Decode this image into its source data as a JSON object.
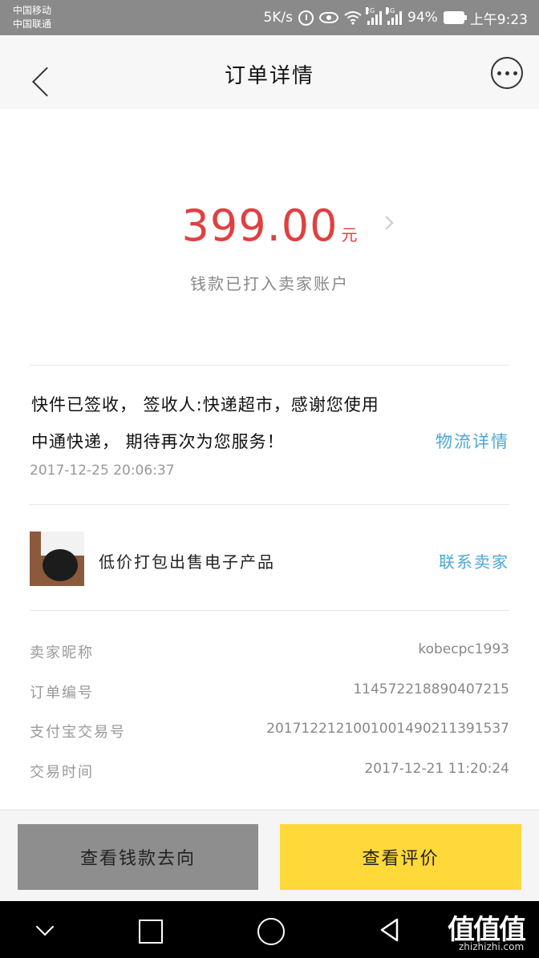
{
  "status_bar": {
    "carrier_1": "中国移动",
    "carrier_2": "中国联通",
    "speed": "5K/s",
    "net_1": "2G",
    "net_2": "4G",
    "battery": "94%",
    "time": "上午9:23"
  },
  "nav": {
    "title": "订单详情",
    "back_icon": "chevron-left-icon",
    "more_icon": "more-horizontal-icon"
  },
  "payment": {
    "amount": "399.00",
    "currency": "元",
    "status": "钱款已打入卖家账户"
  },
  "logistics": {
    "line1": "快件已签收， 签收人:快递超市，感谢您使用",
    "line2": "中通快递， 期待再次为您服务！",
    "link": "物流详情",
    "time": "2017-12-25  20:06:37"
  },
  "product": {
    "title": "低价打包出售电子产品",
    "contact": "联系卖家"
  },
  "order_info": [
    {
      "label": "卖家昵称",
      "value": "kobecpc1993"
    },
    {
      "label": "订单编号",
      "value": "114572218890407215"
    },
    {
      "label": "支付宝交易号",
      "value": "2017122121001001490211391537"
    },
    {
      "label": "交易时间",
      "value": "2017-12-21  11:20:24"
    }
  ],
  "actions": {
    "money_flow": "查看钱款去向",
    "view_review": "查看评价"
  },
  "watermark": {
    "logo": "值值值",
    "url": "zhizhizhi.com"
  },
  "colors": {
    "amount": "#e04040",
    "link": "#4aa8d8",
    "primary_button": "#ffd83a",
    "secondary_button": "#8e8e8e"
  }
}
